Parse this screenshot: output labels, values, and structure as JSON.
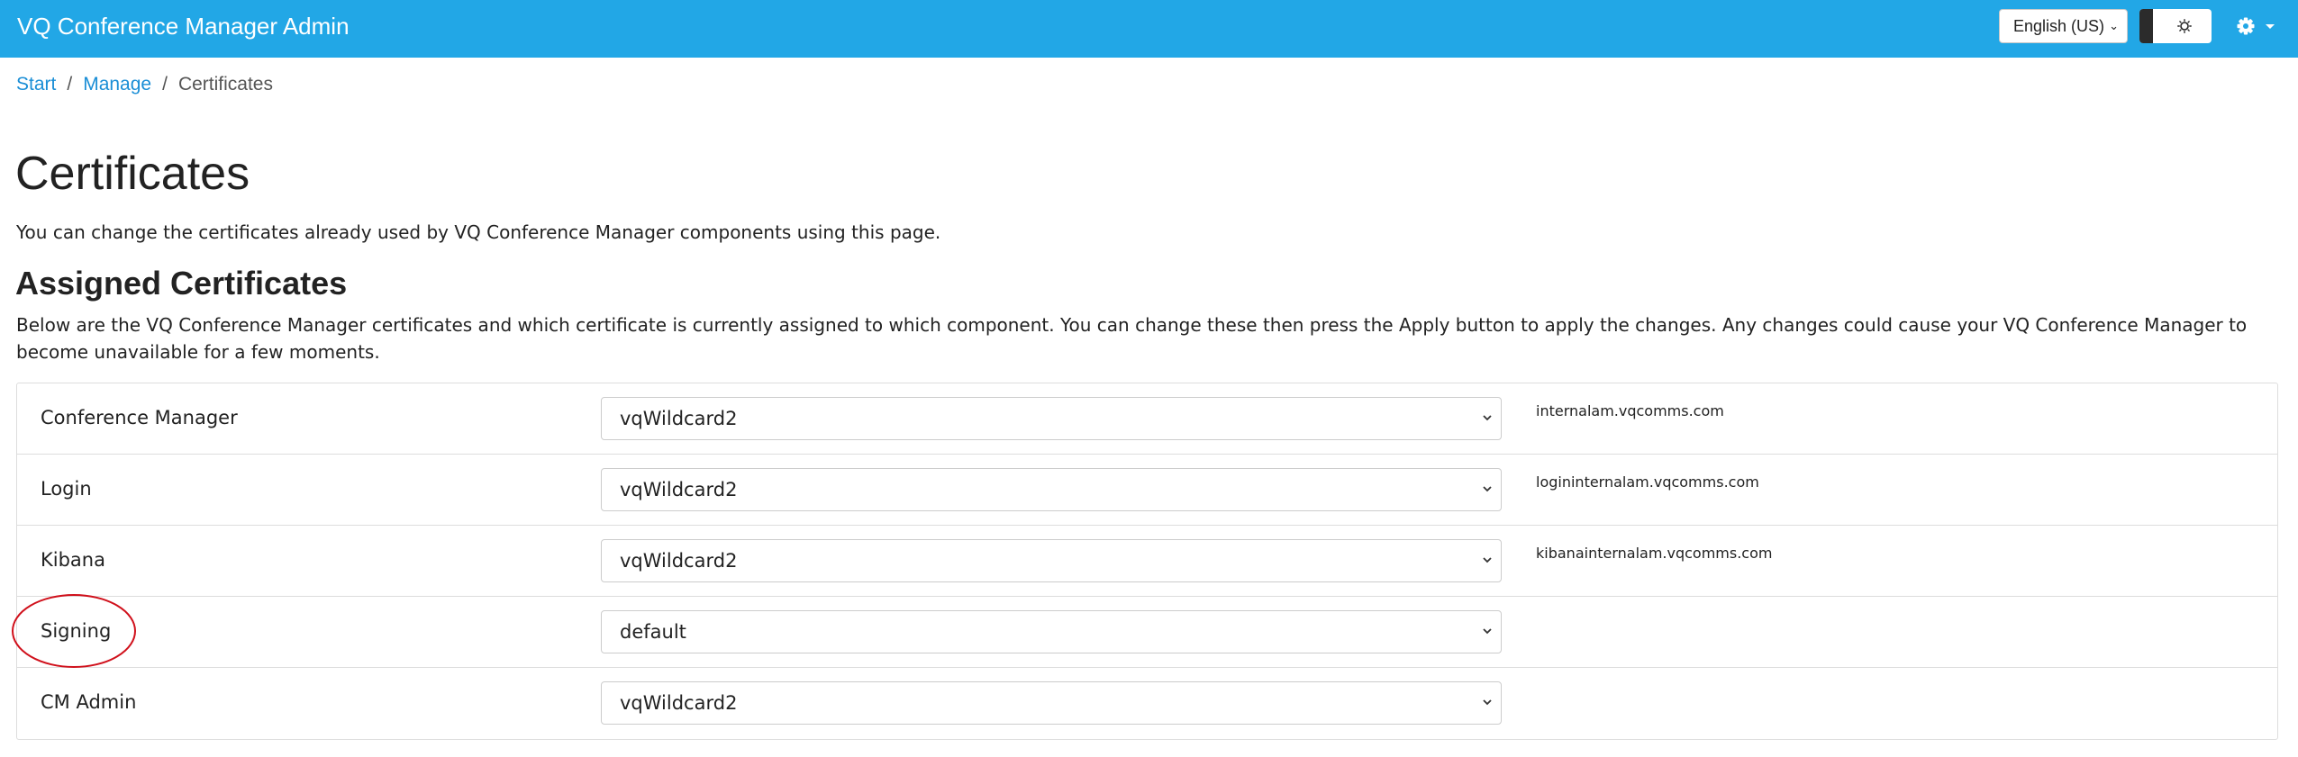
{
  "navbar": {
    "brand": "VQ Conference Manager Admin",
    "language": "English (US)",
    "accent": "#22a7e6"
  },
  "breadcrumb": {
    "items": [
      "Start",
      "Manage",
      "Certificates"
    ],
    "separator": "/"
  },
  "page": {
    "title": "Certificates",
    "intro": "You can change the certificates already used by VQ Conference Manager components using this page."
  },
  "assigned": {
    "title": "Assigned Certificates",
    "description": "Below are the VQ Conference Manager certificates and which certificate is currently assigned to which component. You can change these then press the Apply button to apply the changes. Any changes could cause your VQ Conference Manager to become unavailable for a few moments.",
    "rows": [
      {
        "label": "Conference Manager",
        "certificate": "vqWildcard2",
        "host": "internalam.vqcomms.com"
      },
      {
        "label": "Login",
        "certificate": "vqWildcard2",
        "host": "logininternalam.vqcomms.com"
      },
      {
        "label": "Kibana",
        "certificate": "vqWildcard2",
        "host": "kibanainternalam.vqcomms.com"
      },
      {
        "label": "Signing",
        "certificate": "default",
        "host": ""
      },
      {
        "label": "CM Admin",
        "certificate": "vqWildcard2",
        "host": ""
      }
    ]
  },
  "annotation": {
    "circled_row": "Signing",
    "color": "#d0101b"
  }
}
